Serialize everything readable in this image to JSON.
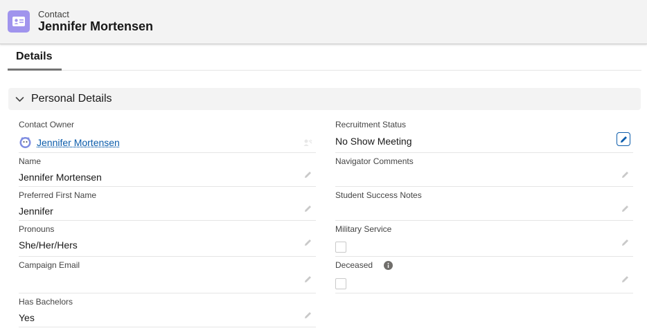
{
  "header": {
    "object_type": "Contact",
    "record_name": "Jennifer Mortensen",
    "icon": "contact-card-icon"
  },
  "tabs": [
    {
      "label": "Details",
      "active": true
    }
  ],
  "section": {
    "title": "Personal Details",
    "expanded": true
  },
  "fields_left": {
    "contact_owner": {
      "label": "Contact Owner",
      "value": "Jennifer Mortensen"
    },
    "name": {
      "label": "Name",
      "value": "Jennifer Mortensen"
    },
    "preferred_first_name": {
      "label": "Preferred First Name",
      "value": "Jennifer"
    },
    "pronouns": {
      "label": "Pronouns",
      "value": "She/Her/Hers"
    },
    "campaign_email": {
      "label": "Campaign Email",
      "value": ""
    },
    "has_bachelors": {
      "label": "Has Bachelors",
      "value": "Yes"
    }
  },
  "fields_right": {
    "recruitment_status": {
      "label": "Recruitment Status",
      "value": "No Show Meeting"
    },
    "navigator_comments": {
      "label": "Navigator Comments",
      "value": ""
    },
    "student_success_notes": {
      "label": "Student Success Notes",
      "value": ""
    },
    "military_service": {
      "label": "Military Service",
      "checked": false
    },
    "deceased": {
      "label": "Deceased",
      "checked": false
    }
  },
  "colors": {
    "accent": "#0b5cab",
    "header_icon_bg": "#a094ed",
    "header_bg": "#f3f3f3"
  }
}
